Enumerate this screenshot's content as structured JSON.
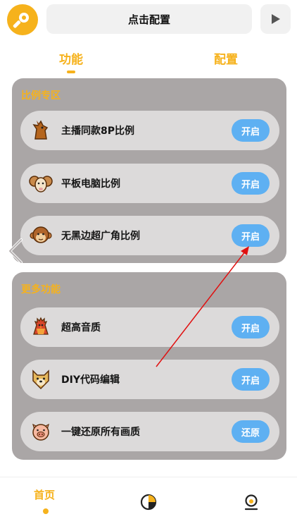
{
  "header": {
    "config_label": "点击配置",
    "logo_icon": "wrench-icon",
    "play_icon": "play-icon"
  },
  "tabs": [
    {
      "label": "功能",
      "active": true
    },
    {
      "label": "配置",
      "active": false
    }
  ],
  "panels": [
    {
      "title": "比例专区",
      "rows": [
        {
          "icon": "horse-icon",
          "label": "主播同款8P比例",
          "button": "开启"
        },
        {
          "icon": "ram-icon",
          "label": "平板电脑比例",
          "button": "开启"
        },
        {
          "icon": "monkey-icon",
          "label": "无黑边超广角比例",
          "button": "开启"
        }
      ]
    },
    {
      "title": "更多功能",
      "rows": [
        {
          "icon": "rooster-icon",
          "label": "超高音质",
          "button": "开启"
        },
        {
          "icon": "dog-icon",
          "label": "DIY代码编辑",
          "button": "开启"
        },
        {
          "icon": "pig-icon",
          "label": "一键还原所有画质",
          "button": "还原"
        }
      ]
    }
  ],
  "bottom_nav": {
    "home_label": "首页",
    "stats_icon": "pie-chart-icon",
    "profile_icon": "profile-icon"
  },
  "colors": {
    "accent": "#f6b21c",
    "button": "#5eb0f2",
    "panel": "#aaa6a6",
    "row": "#dcdada",
    "annotation_arrow": "#e01010"
  }
}
